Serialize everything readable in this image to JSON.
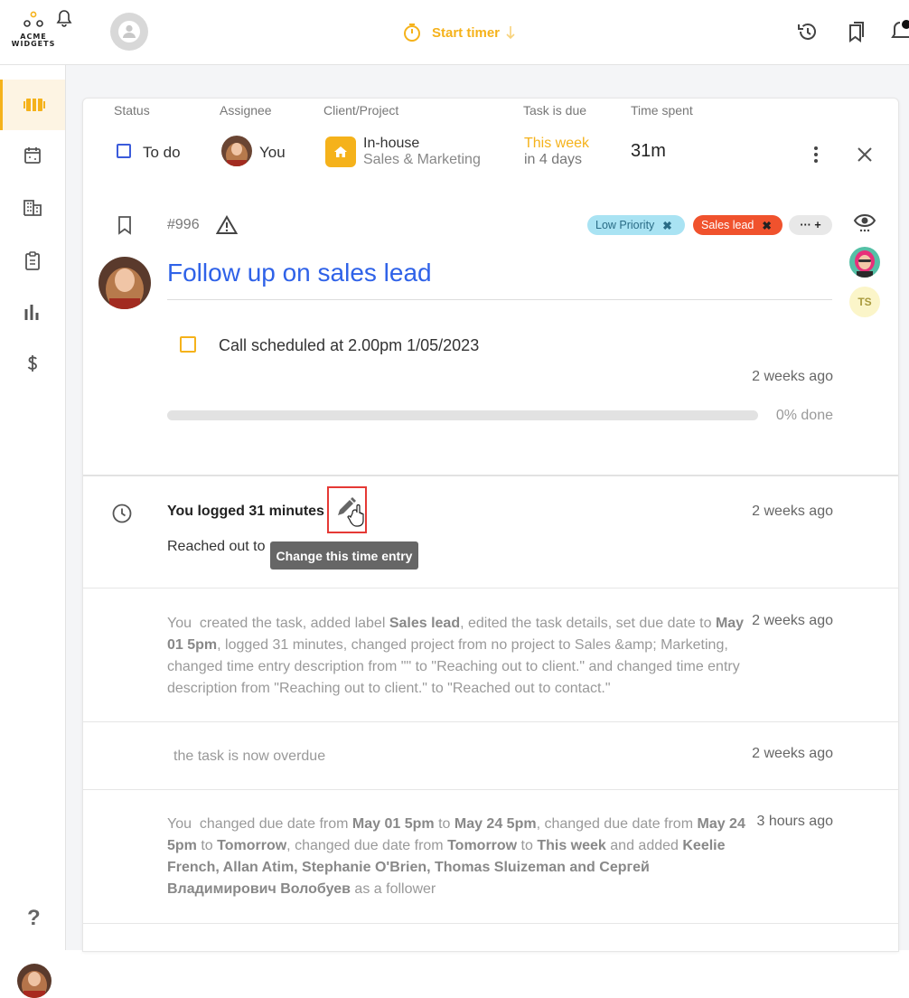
{
  "app": {
    "brand_line1": "ACME",
    "brand_line2": "WIDGETS",
    "timer_label": "Start timer"
  },
  "header": {
    "status_label": "Status",
    "assignee_label": "Assignee",
    "project_label": "Client/Project",
    "due_label": "Task is due",
    "time_label": "Time spent",
    "status_value": "To do",
    "assignee_value": "You",
    "client_value": "In-house",
    "project_value": "Sales & Marketing",
    "due_value": "This week",
    "due_sub": "in 4 days",
    "time_value": "31m"
  },
  "task": {
    "number": "#996",
    "title": "Follow up on sales lead",
    "tags": [
      {
        "label": "Low Priority",
        "bg": "#a9e3f3",
        "color": "#2a6c86"
      },
      {
        "label": "Sales lead",
        "bg": "#f0522d",
        "color": "#ffffff"
      },
      {
        "label": "··· +"
      }
    ],
    "follower_initials": "TS",
    "checklist_item": "Call scheduled at 2.00pm 1/05/2023",
    "checklist_time": "2 weeks ago",
    "progress_pct": 0,
    "progress_text": "0% done"
  },
  "log": {
    "title": "You logged 31 minutes",
    "desc_visible": "Reached out to",
    "time": "2 weeks ago",
    "tooltip": "Change this time entry"
  },
  "activity": [
    {
      "time": "2 weeks ago"
    },
    {
      "text": "the task is now overdue",
      "time": "2 weeks ago"
    },
    {
      "time": "3 hours ago"
    }
  ],
  "colors": {
    "accent": "#f5b21b",
    "link": "#2f62e8",
    "todo": "#3b5bdb"
  }
}
